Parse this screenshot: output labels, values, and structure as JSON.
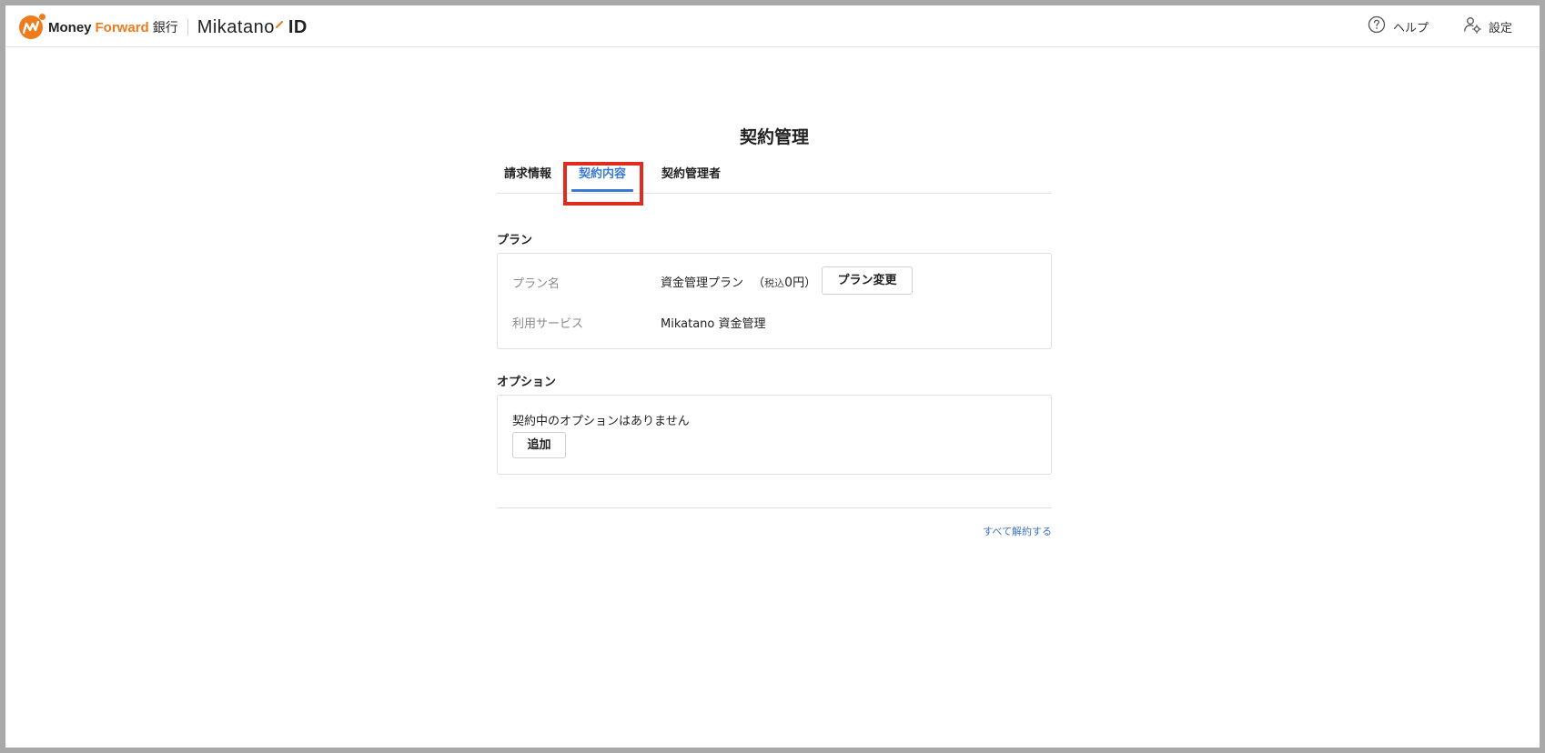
{
  "header": {
    "brand_money": "Money",
    "brand_forward": "Forward",
    "brand_bank": "銀行",
    "brand_product": "Mikatano",
    "brand_id": "ID",
    "help_label": "ヘルプ",
    "settings_label": "設定",
    "accent_color": "#ef7b1d"
  },
  "page": {
    "title": "契約管理"
  },
  "tabs": [
    {
      "label": "請求情報",
      "active": false
    },
    {
      "label": "契約内容",
      "active": true
    },
    {
      "label": "契約管理者",
      "active": false
    }
  ],
  "plan_section": {
    "heading": "プラン",
    "plan_name_label": "プラン名",
    "plan_name_value": "資金管理プラン",
    "paren_open": "（",
    "tax_label": "税込",
    "price": "0",
    "price_unit": "円）",
    "change_button": "プラン変更",
    "service_label": "利用サービス",
    "service_value": "Mikatano 資金管理"
  },
  "option_section": {
    "heading": "オプション",
    "empty_message": "契約中のオプションはありません",
    "add_button": "追加"
  },
  "footer": {
    "cancel_all_link": "すべて解約する",
    "link_color": "#3a6fc4"
  },
  "highlight_color": "#e02b1f"
}
